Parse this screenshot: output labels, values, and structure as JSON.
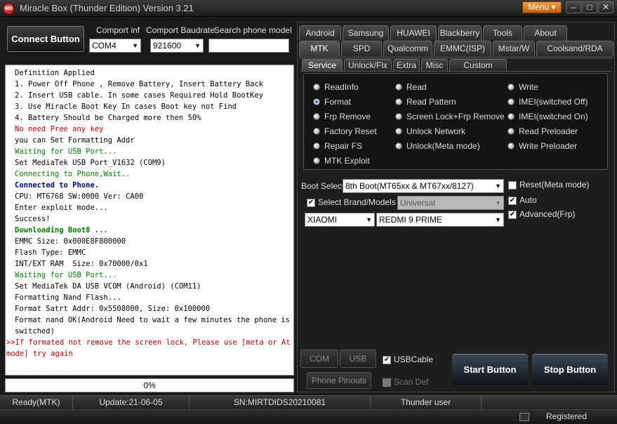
{
  "window": {
    "title": "Miracle Box (Thunder Edition) Version 3.21",
    "logo_text": "MB",
    "menu_label": "Menu ▾",
    "minimize": "–",
    "restore": "□",
    "close": "✕"
  },
  "connect": {
    "button_label": "Connect Button",
    "comport_label": "Comport inf",
    "comport_value": "COM4",
    "baudrate_label": "Comport Baudrate",
    "baudrate_value": "921600",
    "search_label": "Search phone model",
    "search_value": ""
  },
  "log": {
    "lines": [
      {
        "text": "Definition Applied",
        "color": "#000000",
        "bold": false
      },
      {
        "text": "1. Power Off Phone , Remove Battery, Insert Battery Back",
        "color": "#000000",
        "bold": false
      },
      {
        "text": "2. Insert USB cable. In some cases Required Hold BootKey",
        "color": "#000000",
        "bold": false
      },
      {
        "text": "3. Use Miracle Boot Key In cases Boot key not Find",
        "color": "#000000",
        "bold": false
      },
      {
        "text": "4. Battery Should be Charged more then 50%",
        "color": "#000000",
        "bold": false
      },
      {
        "text": "No need Pree any key",
        "color": "#c00000",
        "bold": false
      },
      {
        "text": "you can Set Formatting Addr",
        "color": "#000000",
        "bold": false
      },
      {
        "text": "Waiting for USB Port...",
        "color": "#008000",
        "bold": false
      },
      {
        "text": "Set MediaTek USB Port_V1632 (COM9)",
        "color": "#000000",
        "bold": false
      },
      {
        "text": "Connecting to Phone,Wait..",
        "color": "#008000",
        "bold": false
      },
      {
        "text": "Connected to Phone.",
        "color": "#000080",
        "bold": true
      },
      {
        "text": "CPU: MT6768 SW:0000 Ver: CA00",
        "color": "#000000",
        "bold": false
      },
      {
        "text": "Enter exploit mode...",
        "color": "#000000",
        "bold": false
      },
      {
        "text": "Success!",
        "color": "#000000",
        "bold": false
      },
      {
        "text": "Downloading Boot8 ...",
        "color": "#008000",
        "bold": true
      },
      {
        "text": "EMMC Size: 0x000E8F800000",
        "color": "#000000",
        "bold": false
      },
      {
        "text": "Flash Type: EMMC",
        "color": "#000000",
        "bold": false
      },
      {
        "text": "INT/EXT RAM  Size: 0x70000/0x1",
        "color": "#000000",
        "bold": false
      },
      {
        "text": "Waiting for USB Port...",
        "color": "#008000",
        "bold": false
      },
      {
        "text": "Set MediaTek DA USB VCOM (Android) (COM11)",
        "color": "#000000",
        "bold": false
      },
      {
        "text": "Formatting Nand Flash...",
        "color": "#000000",
        "bold": false
      },
      {
        "text": "Format Satrt Addr: 0x5508000, Size: 0x100000",
        "color": "#000000",
        "bold": false
      },
      {
        "text": "Format nand OK(Android Need to wait a few minutes the phone is switched)",
        "color": "#000000",
        "bold": false
      },
      {
        "text": ">>If formated not remove the screen lock, Please use [meta or At mode] try again",
        "color": "#c00000",
        "bold": false,
        "outdent": true
      }
    ]
  },
  "progress": {
    "label": "0%",
    "value": 0
  },
  "status": {
    "mode": "Ready(MTK)",
    "update": "Update:21-06-05",
    "serial": "SN:MIRTDIDS20210081",
    "user": "Thunder user",
    "registered": "Registered"
  },
  "tabs_row1": [
    "Android",
    "Samsung",
    "HUAWEI",
    "Blackberry",
    "Tools",
    "About"
  ],
  "tabs_row2": [
    "MTK",
    "SPD",
    "Qualcomm",
    "EMMC(ISP)",
    "Mstar/W",
    "Coolsand/RDA"
  ],
  "subtabs": [
    "Service",
    "Unlock/Fix",
    "Extra",
    "Misc",
    "Custom Setting"
  ],
  "operations": {
    "col1": [
      "ReadInfo",
      "Format",
      "Frp Remove",
      "Factory Reset",
      "Repair FS",
      "MTK Exploit"
    ],
    "col2": [
      "Read",
      "Read Pattern",
      "Screen Lock+Frp Remove",
      "Unlock Network",
      "Unlock(Meta mode)"
    ],
    "col3": [
      "Write",
      "IMEI(switched Off)",
      "IMEI(switched On)",
      "Read Preloader",
      "Write Preloader"
    ],
    "selected": "Format"
  },
  "boot": {
    "label": "Boot Select:",
    "value": "8th Boot(MT65xx & MT67xx/8127)"
  },
  "brand": {
    "select_label": "Select Brand/Models",
    "select_checked": true,
    "universal_value": "Universal",
    "brand_value": "XIAOMI",
    "model_value": "REDMI 9 PRIME"
  },
  "options": {
    "reset_meta_label": "Reset(Meta mode)",
    "reset_meta_checked": false,
    "auto_label": "Auto",
    "auto_checked": true,
    "advanced_label": "Advanced(Frp)",
    "advanced_checked": true
  },
  "bottom": {
    "com_scan": "COM Scan",
    "usb_scan": "USB Scan",
    "phone_pinouts": "Phone Pinouts",
    "usbcable_label": "USBCable",
    "usbcable_checked": true,
    "scan_def_label": "Scan Def",
    "scan_def_checked": false,
    "start_label": "Start Button",
    "stop_label": "Stop Button"
  },
  "check_mark": "✔",
  "arrow_glyph": "▼"
}
